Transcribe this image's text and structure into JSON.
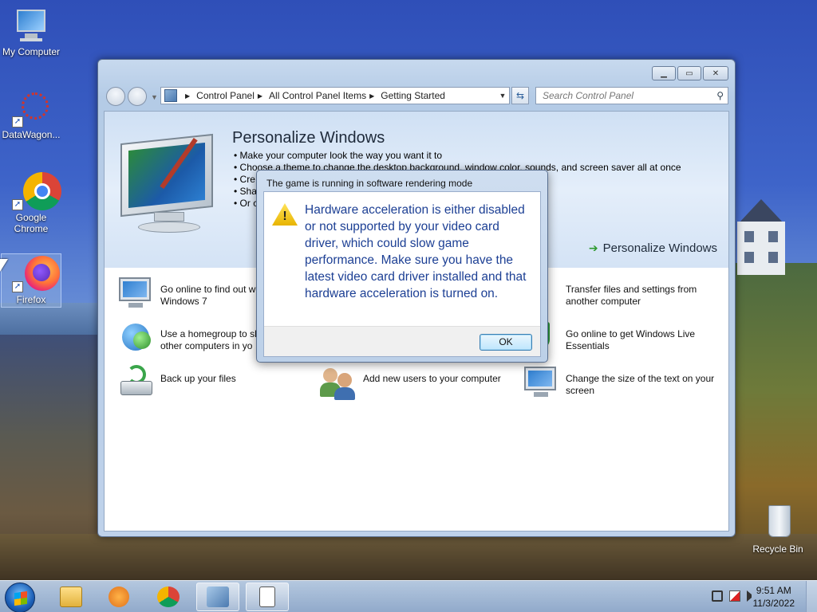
{
  "desktop": {
    "icons": [
      {
        "label": "My Computer"
      },
      {
        "label": "DataWagon..."
      },
      {
        "label": "Google Chrome"
      },
      {
        "label": "Firefox"
      },
      {
        "label": "Recycle Bin"
      }
    ]
  },
  "explorer": {
    "breadcrumb": [
      "Control Panel",
      "All Control Panel Items",
      "Getting Started"
    ],
    "search_placeholder": "Search Control Panel",
    "banner": {
      "title": "Personalize Windows",
      "bullets": [
        "• Make your computer look the way you want it to",
        "• Choose a theme to change the desktop background, window color, sounds, and screen saver all at once",
        "• Cre",
        "• Sha",
        "• Or c"
      ],
      "link": "Personalize Windows"
    },
    "tasks": [
      {
        "label": "Go online to find out w\nWindows 7"
      },
      {
        "label": "Transfer files and settings from another computer"
      },
      {
        "label": "Use a homegroup to sh\nother computers in yo"
      },
      {
        "label": "Go online to get Windows Live Essentials"
      },
      {
        "label": "Back up your files"
      },
      {
        "label": "Add new users to your computer"
      },
      {
        "label": "Change the size of the text on your screen"
      }
    ]
  },
  "dialog": {
    "title": "The game is running in software rendering mode",
    "message": "Hardware acceleration is either disabled or not supported by your video card driver, which could slow game performance. Make sure you have the latest video card driver installed and that hardware acceleration is turned on.",
    "ok_label": "OK"
  },
  "taskbar": {
    "time": "9:51 AM",
    "date": "11/3/2022"
  }
}
